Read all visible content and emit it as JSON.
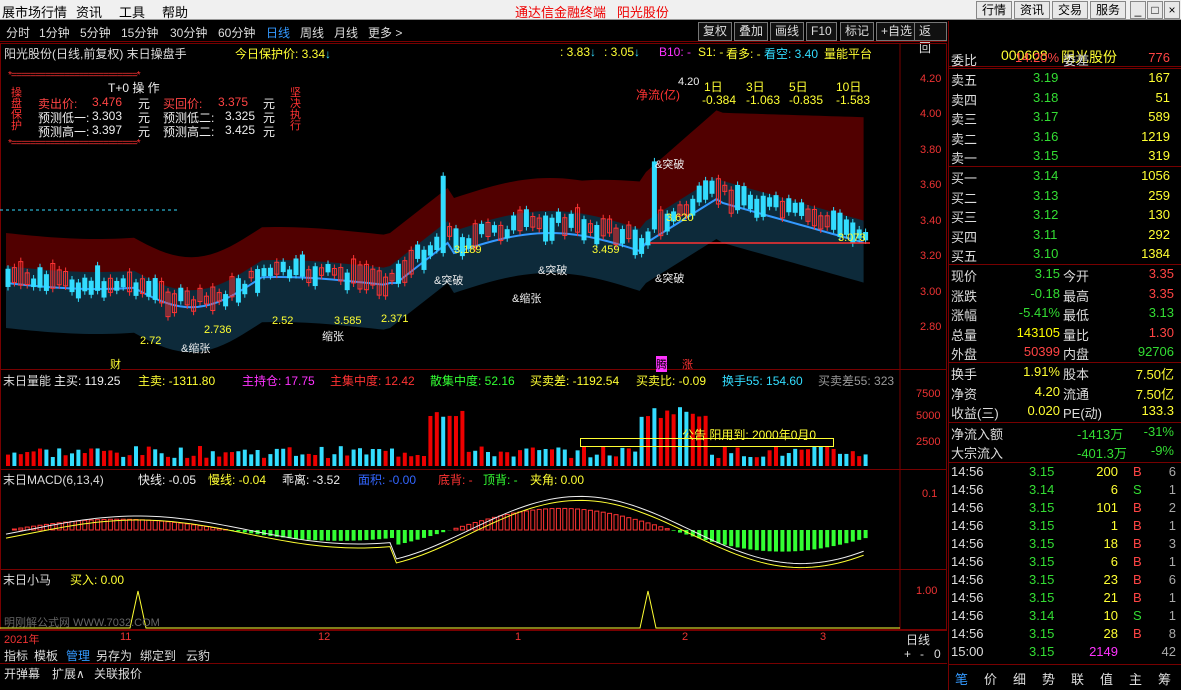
{
  "menu": {
    "items": [
      "展市场行情",
      "资讯",
      "工具",
      "帮助"
    ],
    "center_title": "通达信金融终端",
    "stock_name": "阳光股份",
    "win_buttons": [
      "行情",
      "资讯",
      "交易",
      "服务"
    ]
  },
  "toolbar": {
    "periods": [
      "分时",
      "1分钟",
      "5分钟",
      "15分钟",
      "30分钟",
      "60分钟",
      "日线",
      "周线",
      "月线",
      "更多 >"
    ],
    "active_period": "日线",
    "right_buttons": [
      "复权",
      "叠加",
      "画线",
      "F10",
      "标记",
      "+自选",
      "返回"
    ]
  },
  "chart_title": {
    "name": "阳光股份(日线,前复权) 末日操盘手",
    "protect": "今日保护价: 3.34",
    "p1": ": 3.83",
    "p2": ": 3.05",
    "b10": "B10: -",
    "s1": "S1: -",
    "see_up": "看多: -",
    "see_down": "看空: 3.40",
    "vol_balance": "量能平台"
  },
  "t0": {
    "title": "T+0 操 作",
    "left_tag": "操盘保护",
    "right_tag": "坚决执行",
    "sell_label": "卖出价:",
    "sell": "3.476",
    "buy_label": "买回价:",
    "buy": "3.375",
    "low1_label": "预测低一:",
    "low1": "3.303",
    "low2_label": "预测低二:",
    "low2": "3.325",
    "high1_label": "预测高一:",
    "high1": "3.397",
    "high2_label": "预测高二:",
    "high2": "3.425",
    "unit": "元"
  },
  "flow": {
    "label": "净流(亿)",
    "headers": [
      "1日",
      "3日",
      "5日",
      "10日"
    ],
    "values": [
      "-0.384",
      "-1.063",
      "-0.835",
      "-1.583"
    ]
  },
  "annotations": {
    "price420": "4.20",
    "price3189": "3.189",
    "price372": "2.72",
    "price2736": "2.736",
    "price252": "2.52",
    "price3585": "3.585",
    "price2371": "2.371",
    "price3620": "3.620",
    "price3459": "3.459",
    "price3073": "3.073",
    "break": "&突破",
    "shrink": "&缩张",
    "shrink2": "缩张",
    "cai": "财",
    "teng": "腾",
    "zhang": "涨",
    "holder": "公告 阳用到: 2000年0月0"
  },
  "price_axis": [
    "4.20",
    "4.00",
    "3.80",
    "3.60",
    "3.40",
    "3.20",
    "3.00",
    "2.80"
  ],
  "vol_panel": {
    "title": "末日量能",
    "main_buy": "主买: 119.25",
    "main_sell": "主卖: -1311.80",
    "main_hold": "主持仓: 17.75",
    "main_conc": "主集中度: 12.42",
    "retail_conc": "散集中度: 52.16",
    "buy_sell_diff": "买卖差: -1192.54",
    "buy_sell_ratio": "买卖比: -0.09",
    "turnover": "换手55: 154.60",
    "diff55": "买卖差55: 323",
    "axis": [
      "7500",
      "5000",
      "2500"
    ]
  },
  "macd_panel": {
    "title": "末日MACD(6,13,4)",
    "fast": "快线: -0.05",
    "slow": "慢线: -0.04",
    "diverge": "乖离: -3.52",
    "area": "面积: -0.00",
    "bottom": "底背: -",
    "top": "顶背: -",
    "angle": "夹角: 0.00",
    "axis": "0.1"
  },
  "horse_panel": {
    "title": "末日小马",
    "buy": "买入: 0.00",
    "axis": "1.00",
    "watermark": "明刚解公式网 WWW.7032.COM"
  },
  "time_axis": {
    "labels": [
      "2021年",
      "11",
      "12",
      "1",
      "2",
      "3"
    ],
    "period": "日线"
  },
  "bottom_tabs": [
    "指标",
    "模板",
    "管理",
    "另存为",
    "绑定到",
    "云豹"
  ],
  "bottom_tabs2": [
    "开弹幕",
    "扩展∧",
    "关联报价"
  ],
  "zoom": [
    "+",
    "-",
    "0"
  ],
  "quote": {
    "code": "000608",
    "name": "阳光股份",
    "weibi_label": "委比",
    "weibi": "14.20%",
    "weicha_label": "委差",
    "weicha": "776",
    "asks": [
      {
        "l": "卖五",
        "p": "3.19",
        "v": "167"
      },
      {
        "l": "卖四",
        "p": "3.18",
        "v": "51"
      },
      {
        "l": "卖三",
        "p": "3.17",
        "v": "589"
      },
      {
        "l": "卖二",
        "p": "3.16",
        "v": "1219"
      },
      {
        "l": "卖一",
        "p": "3.15",
        "v": "319"
      }
    ],
    "bids": [
      {
        "l": "买一",
        "p": "3.14",
        "v": "1056"
      },
      {
        "l": "买二",
        "p": "3.13",
        "v": "259"
      },
      {
        "l": "买三",
        "p": "3.12",
        "v": "130"
      },
      {
        "l": "买四",
        "p": "3.11",
        "v": "292"
      },
      {
        "l": "买五",
        "p": "3.10",
        "v": "1384"
      }
    ],
    "stats": [
      {
        "a": "现价",
        "av": "3.15",
        "b": "今开",
        "bv": "3.35",
        "ac": "#3d3",
        "bc": "#f44"
      },
      {
        "a": "涨跌",
        "av": "-0.18",
        "b": "最高",
        "bv": "3.35",
        "ac": "#3d3",
        "bc": "#f44"
      },
      {
        "a": "涨幅",
        "av": "-5.41%",
        "b": "最低",
        "bv": "3.13",
        "ac": "#3d3",
        "bc": "#3d3"
      },
      {
        "a": "总量",
        "av": "143105",
        "b": "量比",
        "bv": "1.30",
        "ac": "#ff0",
        "bc": "#f44"
      },
      {
        "a": "外盘",
        "av": "50399",
        "b": "内盘",
        "bv": "92706",
        "ac": "#f44",
        "bc": "#3d3"
      }
    ],
    "stats2": [
      {
        "a": "换手",
        "av": "1.91%",
        "b": "股本",
        "bv": "7.50亿"
      },
      {
        "a": "净资",
        "av": "4.20",
        "b": "流通",
        "bv": "7.50亿"
      },
      {
        "a": "收益(三)",
        "av": "0.020",
        "b": "PE(动)",
        "bv": "133.3"
      }
    ],
    "netflow_label": "净流入额",
    "netflow": "-1413万",
    "netflow_pct": "-31%",
    "bigflow_label": "大宗流入",
    "bigflow": "-401.3万",
    "bigflow_pct": "-9%",
    "ticks": [
      {
        "t": "14:56",
        "p": "3.15",
        "v": "200",
        "s": "B",
        "n": "6"
      },
      {
        "t": "14:56",
        "p": "3.14",
        "v": "6",
        "s": "S",
        "n": "1"
      },
      {
        "t": "14:56",
        "p": "3.15",
        "v": "101",
        "s": "B",
        "n": "2"
      },
      {
        "t": "14:56",
        "p": "3.15",
        "v": "1",
        "s": "B",
        "n": "1"
      },
      {
        "t": "14:56",
        "p": "3.15",
        "v": "18",
        "s": "B",
        "n": "3"
      },
      {
        "t": "14:56",
        "p": "3.15",
        "v": "6",
        "s": "B",
        "n": "1"
      },
      {
        "t": "14:56",
        "p": "3.15",
        "v": "23",
        "s": "B",
        "n": "6"
      },
      {
        "t": "14:56",
        "p": "3.15",
        "v": "21",
        "s": "B",
        "n": "1"
      },
      {
        "t": "14:56",
        "p": "3.14",
        "v": "10",
        "s": "S",
        "n": "1"
      },
      {
        "t": "14:56",
        "p": "3.15",
        "v": "28",
        "s": "B",
        "n": "8"
      },
      {
        "t": "15:00",
        "p": "3.15",
        "v": "2149",
        "s": "",
        "n": "42"
      }
    ],
    "tabs": [
      "笔",
      "价",
      "细",
      "势",
      "联",
      "值",
      "主",
      "筹"
    ]
  },
  "colors": {
    "up": "#ff3333",
    "down": "#00ff33",
    "cyan": "#33ddff",
    "yellow": "#ffff00",
    "band": "#5a0000",
    "band2": "#0d2a3a"
  }
}
